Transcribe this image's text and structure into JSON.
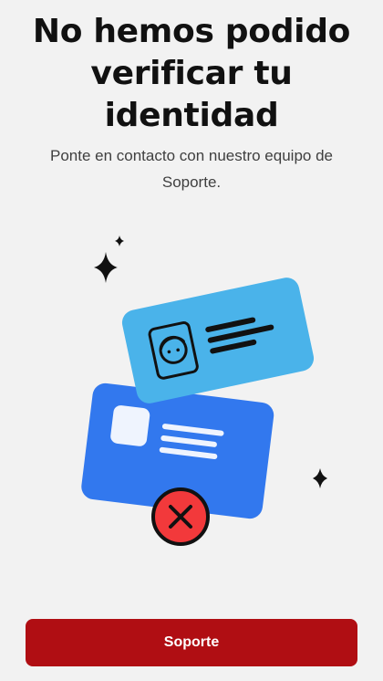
{
  "header": {
    "title": "No hemos podido verificar tu identidad",
    "subtitle": "Ponte en contacto con nuestro equipo de Soporte."
  },
  "illustration": {
    "icons": [
      "sparkle-icon",
      "id-card-icon",
      "face-icon",
      "error-x-icon"
    ],
    "colors": {
      "front_card": "#4ab3ea",
      "back_card": "#3278ee",
      "error_badge": "#f2393b",
      "ink": "#111111"
    }
  },
  "footer": {
    "support_label": "Soporte"
  },
  "theme": {
    "background": "#f2f2f2",
    "primary_button": "#b00e13"
  }
}
